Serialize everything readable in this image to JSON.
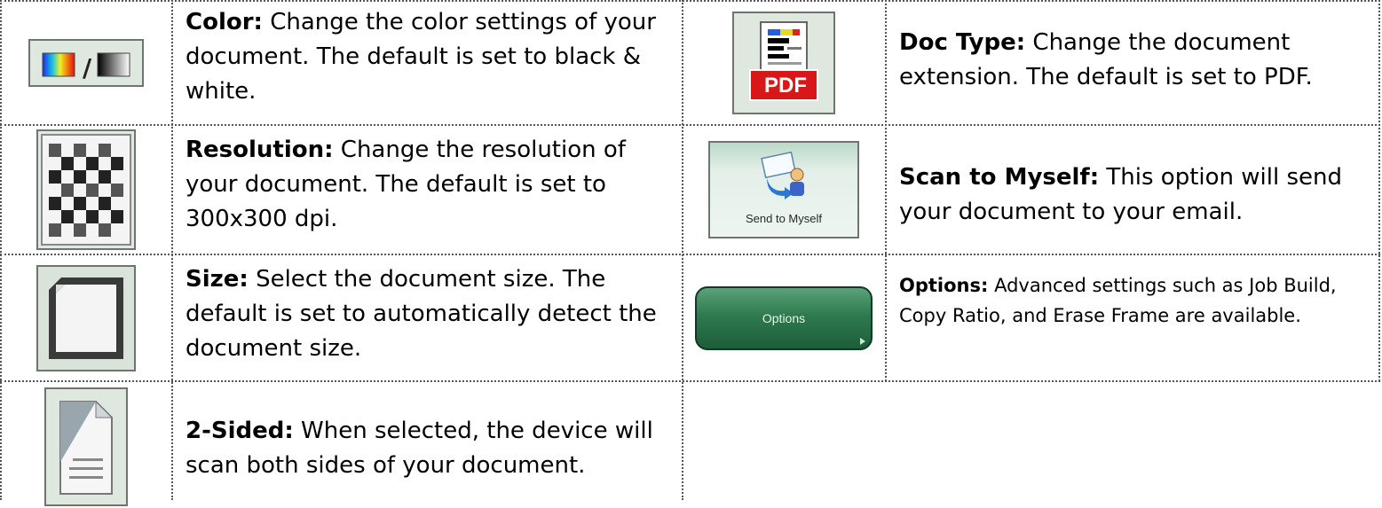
{
  "rows": [
    {
      "left": {
        "icon": "color-mode-icon",
        "term": "Color:",
        "desc": " Change the color settings of your document. The default is set to black & white."
      },
      "right": {
        "icon": "pdf-doc-type-icon",
        "term": "Doc Type:",
        "desc": " Change the document extension. The default is set to PDF.",
        "icon_text": "PDF"
      }
    },
    {
      "left": {
        "icon": "resolution-checker-icon",
        "term": "Resolution:",
        "desc": " Change the resolution of your document. The default is set to 300x300 dpi."
      },
      "right": {
        "icon": "send-to-myself-icon",
        "term": "Scan to Myself:",
        "desc": " This option will send your document to your email.",
        "icon_text": "Send to Myself"
      }
    },
    {
      "left": {
        "icon": "size-frame-icon",
        "term": "Size:",
        "desc": " Select the document size. The default is set to automatically detect the document size."
      },
      "right": {
        "icon": "options-button",
        "term": "Options:",
        "desc": " Advanced settings such as Job Build, Copy Ratio, and Erase Frame are available.",
        "icon_text": "Options"
      }
    },
    {
      "left": {
        "icon": "two-sided-page-icon",
        "term": "2-Sided:",
        "desc": " When selected, the device will scan both sides of your document."
      }
    }
  ]
}
